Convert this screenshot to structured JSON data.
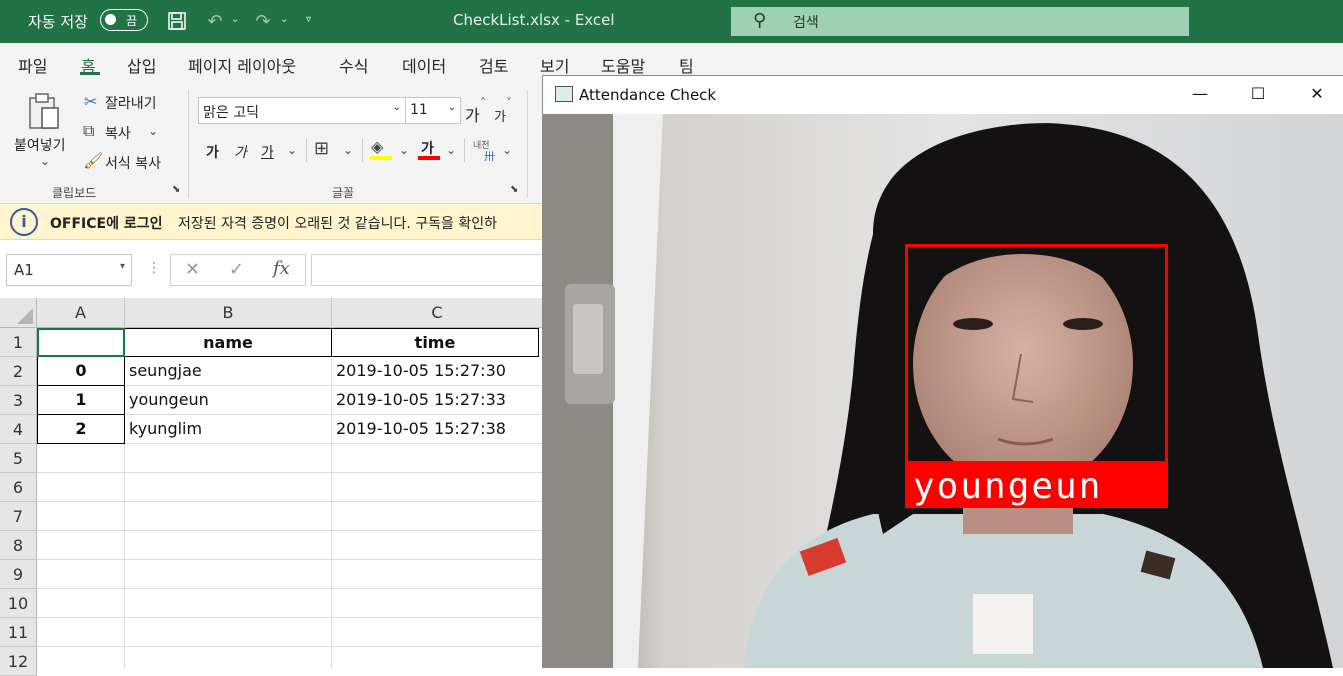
{
  "titlebar": {
    "autosave_label": "자동 저장",
    "autosave_state": "끔",
    "doc_title": "CheckList.xlsx  -  Excel",
    "search_placeholder": "검색"
  },
  "ribbon": {
    "tabs": [
      "파일",
      "홈",
      "삽입",
      "페이지 레이아웃",
      "수식",
      "데이터",
      "검토",
      "보기",
      "도움말",
      "팀"
    ],
    "active_tab": "홈",
    "clipboard": {
      "paste_label": "붙여넣기",
      "cut_label": "잘라내기",
      "copy_label": "복사",
      "format_painter_label": "서식 복사",
      "group_label": "클립보드"
    },
    "font": {
      "font_name": "맑은 고딕",
      "font_size": "11",
      "grow_label": "가",
      "shrink_label": "가",
      "bold_label": "가",
      "italic_label": "가",
      "underline_label": "가",
      "font_color_label": "가",
      "phonetic_label": "내천",
      "group_label": "글꼴"
    }
  },
  "messagebar": {
    "title": "OFFICE에 로그인",
    "text": "저장된 자격 증명이 오래된 것 같습니다. 구독을 확인하"
  },
  "formula_bar": {
    "name_box": "A1",
    "fx_label": "fx",
    "formula": ""
  },
  "sheet": {
    "columns": [
      "A",
      "B",
      "C"
    ],
    "rows": [
      "1",
      "2",
      "3",
      "4",
      "5",
      "6",
      "7",
      "8",
      "9",
      "10",
      "11",
      "12"
    ],
    "header": [
      "",
      "name",
      "time"
    ],
    "data": [
      [
        "0",
        "seungjae",
        "2019-10-05 15:27:30"
      ],
      [
        "1",
        "youngeun",
        "2019-10-05 15:27:33"
      ],
      [
        "2",
        "kyunglim",
        "2019-10-05 15:27:38"
      ]
    ]
  },
  "cv_window": {
    "title": "Attendance Check",
    "minimize_label": "—",
    "maximize_label": "☐",
    "close_label": "✕",
    "detected_name": "youngeun",
    "box_color": "#ff0000"
  },
  "colors": {
    "excel_green": "#217346",
    "message_yellow": "#fff4ce"
  }
}
